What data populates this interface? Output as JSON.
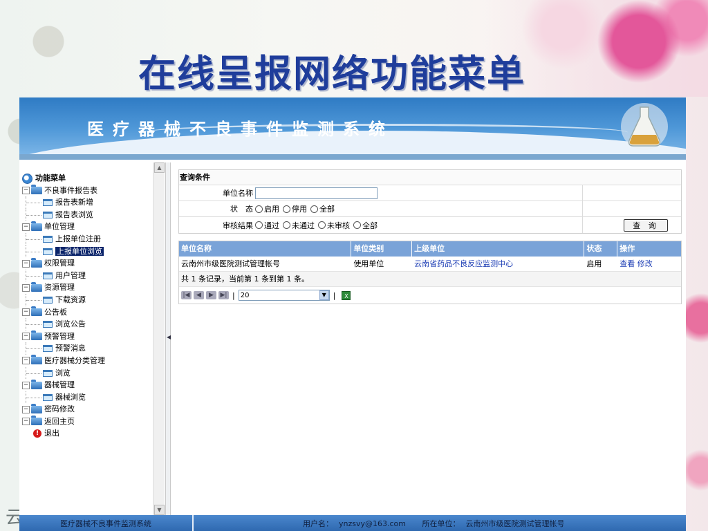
{
  "slide": {
    "title": "在线呈报网络功能菜单",
    "side_char": "云"
  },
  "app": {
    "banner_title": "医疗器械不良事件监测系统"
  },
  "menu": {
    "root": "功能菜单",
    "items": [
      {
        "label": "不良事件报告表",
        "level": 1
      },
      {
        "label": "报告表新增",
        "level": 2
      },
      {
        "label": "报告表浏览",
        "level": 2
      },
      {
        "label": "单位管理",
        "level": 1
      },
      {
        "label": "上报单位注册",
        "level": 2
      },
      {
        "label": "上报单位浏览",
        "level": 2,
        "selected": true
      },
      {
        "label": "权限管理",
        "level": 1
      },
      {
        "label": "用户管理",
        "level": 2
      },
      {
        "label": "资源管理",
        "level": 1
      },
      {
        "label": "下载资源",
        "level": 2
      },
      {
        "label": "公告板",
        "level": 1
      },
      {
        "label": "浏览公告",
        "level": 2
      },
      {
        "label": "预警管理",
        "level": 1
      },
      {
        "label": "预警消息",
        "level": 2
      },
      {
        "label": "医疗器械分类管理",
        "level": 1
      },
      {
        "label": "浏览",
        "level": 2
      },
      {
        "label": "器械管理",
        "level": 1
      },
      {
        "label": "器械浏览",
        "level": 2
      },
      {
        "label": "密码修改",
        "level": 1
      },
      {
        "label": "返回主页",
        "level": 1
      }
    ],
    "exit": "退出"
  },
  "query": {
    "title": "查询条件",
    "unit_name_label": "单位名称",
    "unit_name_value": "",
    "status_label": "状　态",
    "status_options": [
      "启用",
      "停用",
      "全部"
    ],
    "review_label": "审核结果",
    "review_options": [
      "通过",
      "未通过",
      "未审核",
      "全部"
    ],
    "search_button": "查 询"
  },
  "results": {
    "headers": [
      "单位名称",
      "单位类别",
      "上级单位",
      "状态",
      "操作"
    ],
    "rows": [
      {
        "name": "云南州市级医院测试管理帐号",
        "category": "使用单位",
        "parent": "云南省药品不良反应监测中心",
        "status": "启用",
        "view": "查看",
        "edit": "修改"
      }
    ],
    "summary": "共 1 条记录，当前第 1 条到第 1 条。",
    "page_size": "20"
  },
  "footer": {
    "system_name": "医疗器械不良事件监测系统",
    "user_label": "用户名：",
    "user_value": "ynzsvy@163.com",
    "unit_label": "所在单位：",
    "unit_value": "云南州市级医院测试管理帐号"
  },
  "colors": {
    "title": "#1f3d9b",
    "header_bg": "#7aa3d8",
    "footer_bg": "#3a76bf",
    "selected_bg": "#0a246a",
    "link": "#1e3fb5"
  }
}
